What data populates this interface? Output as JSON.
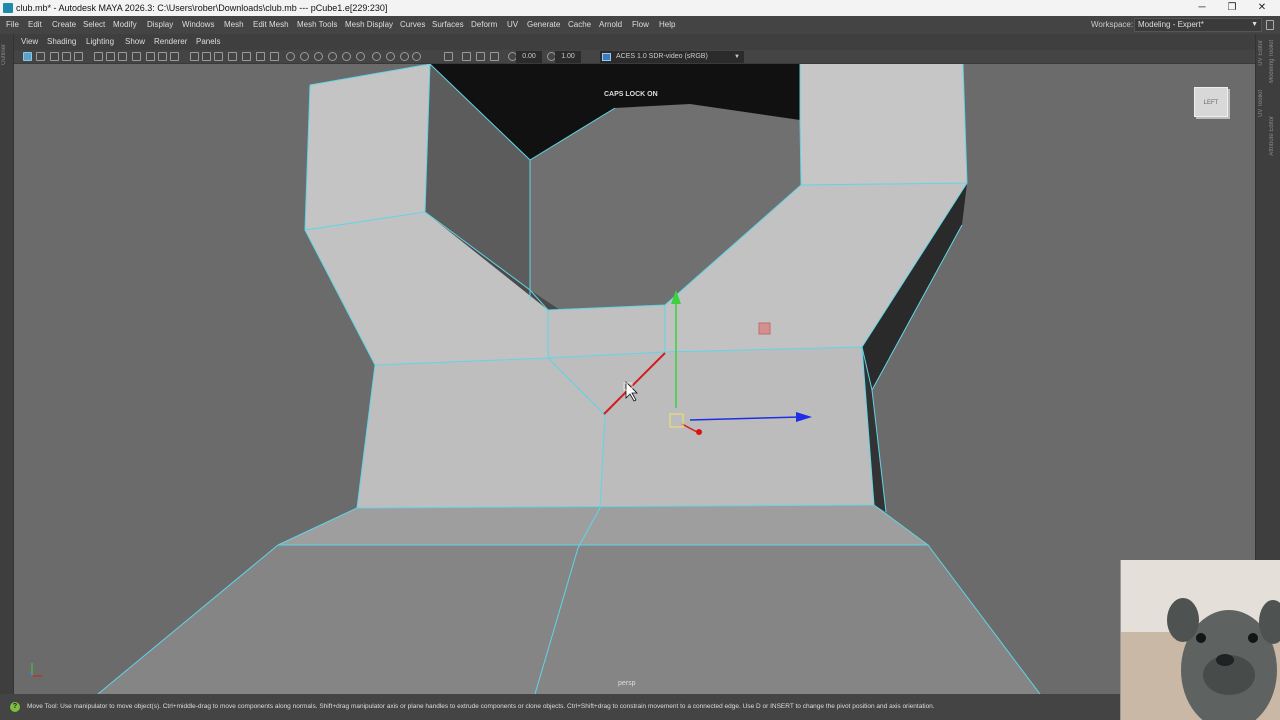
{
  "window": {
    "title": "club.mb* - Autodesk MAYA 2026.3: C:\\Users\\rober\\Downloads\\club.mb   ---   pCube1.e[229:230]",
    "controls": [
      "─",
      "❐",
      "✕"
    ]
  },
  "menubar": {
    "items": [
      "File",
      "Edit",
      "Create",
      "Select",
      "Modify",
      "Display",
      "Windows",
      "Mesh",
      "Edit Mesh",
      "Mesh Tools",
      "Mesh Display",
      "Curves",
      "Surfaces",
      "Deform",
      "UV",
      "Generate",
      "Cache",
      "Arnold",
      "Flow",
      "Help"
    ],
    "workspace_label": "Workspace:",
    "workspace_value": "Modeling - Expert*"
  },
  "side_labels": {
    "left": "Outliner",
    "right": [
      "UV Editor",
      "Modeling Toolkit",
      "UV Toolkit",
      "Attribute Editor"
    ]
  },
  "panel_menu": {
    "items": [
      "View",
      "Shading",
      "Lighting",
      "Show",
      "Renderer",
      "Panels"
    ]
  },
  "panel_toolbar": {
    "exposure": "0.00",
    "gamma": "1.00",
    "colorspace": "ACES 1.0 SDR-video (sRGB)"
  },
  "viewport": {
    "caps_lock": "CAPS LOCK ON",
    "camera": "persp",
    "viewcube_face": "LEFT",
    "colors": {
      "background": "#6b6b6b",
      "wireframe": "#5fd5e8",
      "manip_x": "#d21e1e",
      "manip_y": "#3ed03e",
      "manip_z": "#1e2ee6"
    }
  },
  "helpline": {
    "icon": "help-icon",
    "text": "Move Tool: Use manipulator to move object(s). Ctrl+middle-drag to move components along normals. Shift+drag manipulator axis or plane handles to extrude components or clone objects. Ctrl+Shift+drag to constrain movement to a connected edge. Use D or INSERT to change the pivot position and axis orientation."
  }
}
